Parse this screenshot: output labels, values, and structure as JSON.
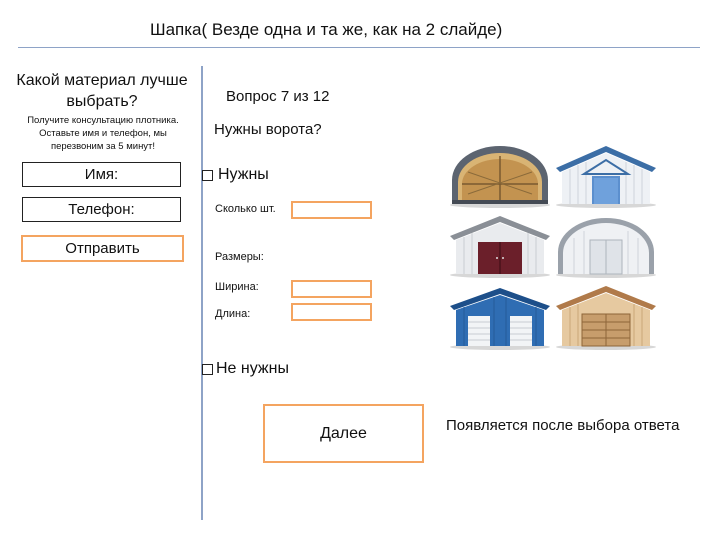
{
  "header": {
    "title": "Шапка( Везде одна и та же, как на 2 слайде)"
  },
  "sidebar": {
    "title": "Какой материал лучше выбрать?",
    "subtitle": "Получите консультацию плотника. Оставьте имя и телефон, мы перезвоним за 5 минут!",
    "name_label": "Имя:",
    "phone_label": "Телефон:",
    "send_label": "Отправить"
  },
  "question": {
    "counter": "Вопрос 7 из 12",
    "text": "Нужны ворота?",
    "option_yes": "Нужны",
    "quantity_label": "Сколько шт.",
    "sizes_label": "Размеры:",
    "width_label": "Ширина:",
    "length_label": "Длина:",
    "option_no": "Не нужны"
  },
  "footer": {
    "next_label": "Далее",
    "note": "Появляется после выбора ответа"
  },
  "colors": {
    "accent_orange": "#f4a460",
    "rule_blue": "#8ea3c7"
  },
  "gallery": [
    {
      "icon": "arched-hangar-wood-icon"
    },
    {
      "icon": "blue-door-warehouse-icon"
    },
    {
      "icon": "red-gate-garage-icon"
    },
    {
      "icon": "arched-hangar-white-icon"
    },
    {
      "icon": "blue-double-garage-icon"
    },
    {
      "icon": "wooden-garage-icon"
    }
  ]
}
